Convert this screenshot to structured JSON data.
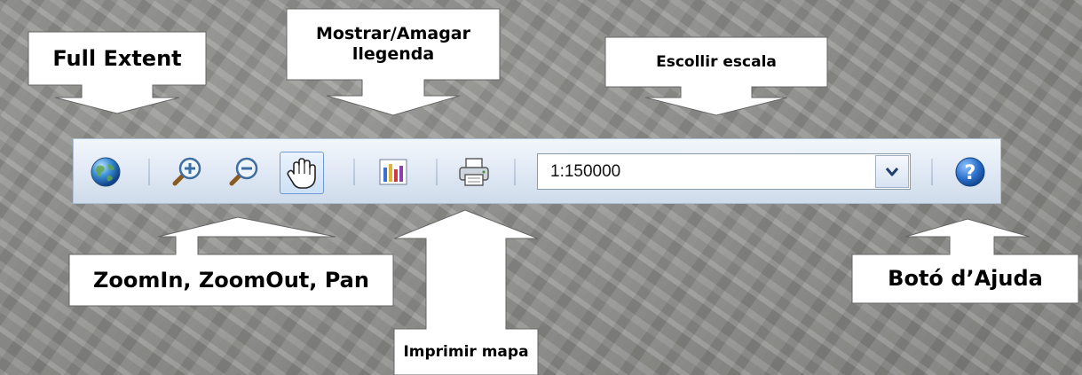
{
  "annotations": {
    "full_extent": "Full Extent",
    "legend_toggle": "Mostrar/Amagar\nllegenda",
    "scale_select": "Escollir escala",
    "zoom_pan": "ZoomIn, ZoomOut, Pan",
    "print_map": "Imprimir mapa",
    "help_button": "Botó d’Ajuda"
  },
  "toolbar": {
    "scale_value": "1:150000",
    "icons": [
      "globe-icon",
      "zoom-in-icon",
      "zoom-out-icon",
      "pan-hand-icon",
      "legend-chart-icon",
      "printer-icon",
      "chevron-down-icon",
      "help-icon"
    ]
  },
  "colors": {
    "toolbar_bg": "#dfe8f4",
    "toolbar_border": "#aebfd6",
    "help_blue": "#2a6fc9",
    "active_tool_border": "#6f9bd0"
  }
}
